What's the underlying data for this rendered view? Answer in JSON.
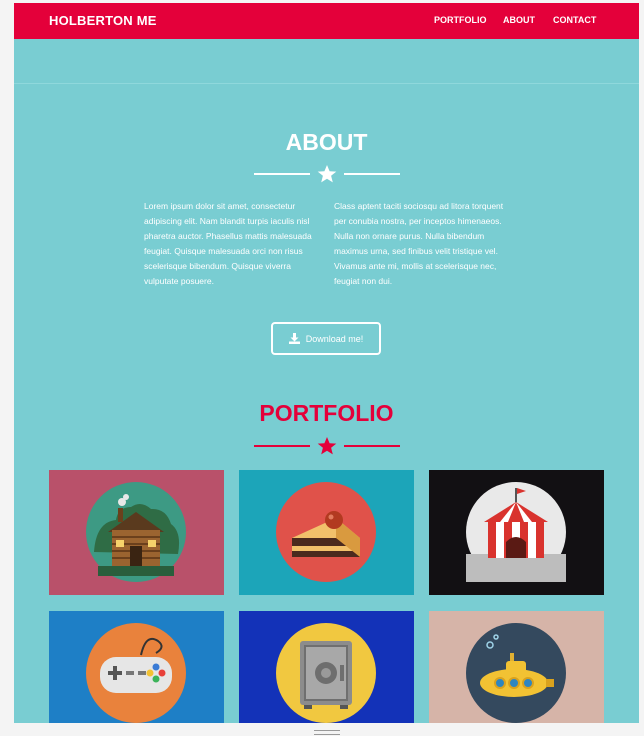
{
  "navbar": {
    "brand": "HOLBERTON ME",
    "links": [
      "PORTFOLIO",
      "ABOUT",
      "CONTACT"
    ]
  },
  "about": {
    "title": "ABOUT",
    "paragraph_left": "Lorem ipsum dolor sit amet, consectetur adipiscing elit. Nam blandit turpis iaculis nisl pharetra auctor. Phasellus mattis malesuada feugiat. Quisque malesuada orci non risus scelerisque bibendum. Quisque viverra vulputate posuere.",
    "paragraph_right": "Class aptent taciti sociosqu ad litora torquent per conubia nostra, per inceptos himenaeos. Nulla non ornare purus. Nulla bibendum maximus urna, sed finibus velit tristique vel. Vivamus ante mi, mollis at scelerisque nec, feugiat non dui.",
    "download_label": "Download me!"
  },
  "portfolio": {
    "title": "PORTFOLIO",
    "items": [
      {
        "icon": "log-cabin-icon",
        "bg": "#b9516a"
      },
      {
        "icon": "cake-slice-icon",
        "bg": "#1ca5b9"
      },
      {
        "icon": "circus-tent-icon",
        "bg": "#121013"
      },
      {
        "icon": "game-controller-icon",
        "bg": "#1e7fc6"
      },
      {
        "icon": "safe-icon",
        "bg": "#1332b8"
      },
      {
        "icon": "submarine-icon",
        "bg": "#d6b4a8"
      }
    ]
  },
  "colors": {
    "accent": "#e4003a",
    "background": "#79cdd2",
    "text_light": "#ffffff"
  }
}
